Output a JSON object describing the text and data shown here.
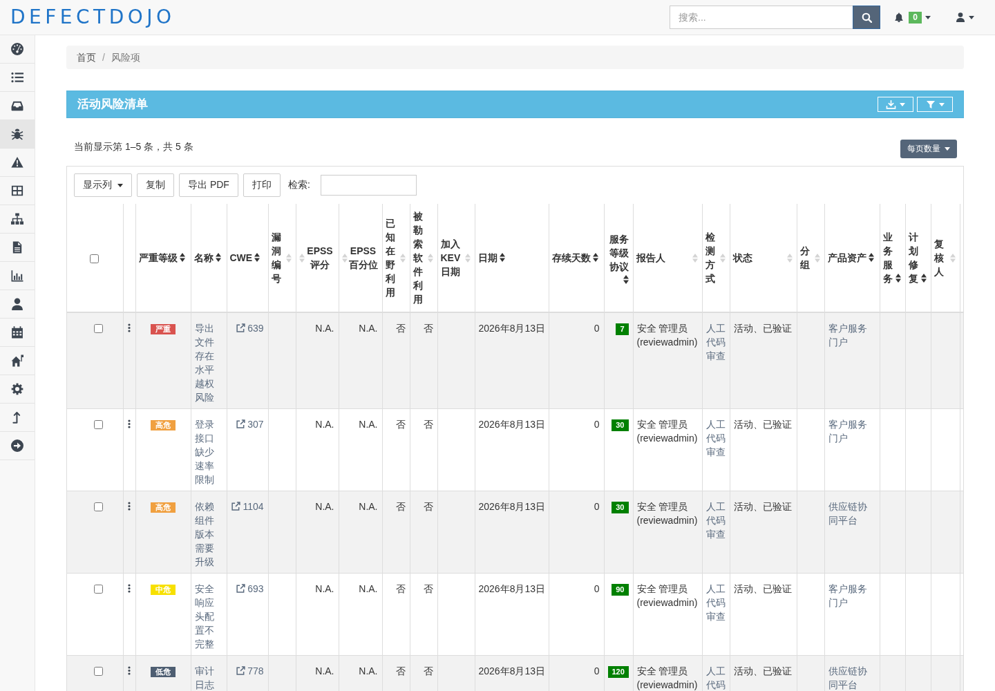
{
  "navbar": {
    "logo": "DEFECTDOJO",
    "search": {
      "placeholder": "搜索..."
    },
    "notifications": {
      "count": "0"
    }
  },
  "sidebar": {
    "items": [
      {
        "kind": "gauge",
        "selected": false
      },
      {
        "kind": "list",
        "selected": false
      },
      {
        "kind": "inbox",
        "selected": false
      },
      {
        "kind": "bug",
        "selected": true
      },
      {
        "kind": "warning",
        "selected": false
      },
      {
        "kind": "grid",
        "selected": false
      },
      {
        "kind": "sitemap",
        "selected": false
      },
      {
        "kind": "document",
        "selected": false
      },
      {
        "kind": "chart",
        "selected": false
      },
      {
        "kind": "user",
        "selected": false
      },
      {
        "kind": "calendar",
        "selected": false
      },
      {
        "kind": "house",
        "selected": false
      },
      {
        "kind": "gear",
        "selected": false
      },
      {
        "kind": "arrow-up",
        "selected": false
      },
      {
        "kind": "arrow-right",
        "selected": false
      }
    ]
  },
  "breadcrumb": {
    "separator": "/",
    "items": [
      {
        "label": "首页",
        "active": false
      },
      {
        "label": "风险项",
        "active": true
      }
    ]
  },
  "panel": {
    "title": "活动风险清单",
    "summary": "当前显示第 1–5 条，共 5 条",
    "page_size_button": "每页数量"
  },
  "toolbar": {
    "buttons": [
      {
        "label": "显示列",
        "dropdown": true
      },
      {
        "label": "复制",
        "dropdown": false
      },
      {
        "label": "导出 PDF",
        "dropdown": false
      },
      {
        "label": "打印",
        "dropdown": false
      }
    ],
    "search_label": "检索:"
  },
  "table": {
    "select_all": {
      "checked": false
    },
    "columns": [
      {
        "label": "严重等级",
        "sortable": true
      },
      {
        "label": "名称",
        "sortable": true
      },
      {
        "label": "CWE",
        "sortable": true
      },
      {
        "label": "漏洞编号",
        "sortable": false
      },
      {
        "label": "EPSS 评分",
        "sortable": false
      },
      {
        "label": "EPSS 百分位",
        "sortable": false
      },
      {
        "label": "已知在野利用",
        "sortable": false
      },
      {
        "label": "被勒索软件利用",
        "sortable": false
      },
      {
        "label": "加入KEV日期",
        "sortable": false
      },
      {
        "label": "日期",
        "sortable": true
      },
      {
        "label": "存续天数",
        "sortable": true
      },
      {
        "label": "服务等级协议",
        "sortable": true
      },
      {
        "label": "报告人",
        "sortable": false
      },
      {
        "label": "检测方式",
        "sortable": false
      },
      {
        "label": "状态",
        "sortable": false
      },
      {
        "label": "分组",
        "sortable": false
      },
      {
        "label": "产品资产",
        "sortable": true
      },
      {
        "label": "业务服务",
        "sortable": true
      },
      {
        "label": "计划修复",
        "sortable": true
      },
      {
        "label": "复核人",
        "sortable": false
      }
    ],
    "rows": [
      {
        "checked": false,
        "severity": {
          "label": "严重",
          "color": "#d9534f"
        },
        "name": "导出文件存在水平越权风险",
        "cwe": "639",
        "epss_score": "N.A.",
        "epss_percentile": "N.A.",
        "known_exploited": "否",
        "ransomware": "否",
        "date": "2026年8月13日",
        "age": "0",
        "sla": "7",
        "reporter": "安全 管理员 (reviewadmin)",
        "detection": "人工代码审查",
        "status": "活动、已验证",
        "product": "客户服务门户"
      },
      {
        "checked": false,
        "severity": {
          "label": "高危",
          "color": "#f0a040"
        },
        "name": "登录接口缺少速率限制",
        "cwe": "307",
        "epss_score": "N.A.",
        "epss_percentile": "N.A.",
        "known_exploited": "否",
        "ransomware": "否",
        "date": "2026年8月13日",
        "age": "0",
        "sla": "30",
        "reporter": "安全 管理员 (reviewadmin)",
        "detection": "人工代码审查",
        "status": "活动、已验证",
        "product": "客户服务门户"
      },
      {
        "checked": false,
        "severity": {
          "label": "高危",
          "color": "#f0a040"
        },
        "name": "依赖组件版本需要升级",
        "cwe": "1104",
        "epss_score": "N.A.",
        "epss_percentile": "N.A.",
        "known_exploited": "否",
        "ransomware": "否",
        "date": "2026年8月13日",
        "age": "0",
        "sla": "30",
        "reporter": "安全 管理员 (reviewadmin)",
        "detection": "人工代码审查",
        "status": "活动、已验证",
        "product": "供应链协同平台"
      },
      {
        "checked": false,
        "severity": {
          "label": "中危",
          "color": "#f7e000"
        },
        "name": "安全响应头配置不完整",
        "cwe": "693",
        "epss_score": "N.A.",
        "epss_percentile": "N.A.",
        "known_exploited": "否",
        "ransomware": "否",
        "date": "2026年8月13日",
        "age": "0",
        "sla": "90",
        "reporter": "安全 管理员 (reviewadmin)",
        "detection": "人工代码审查",
        "status": "活动、已验证",
        "product": "客户服务门户"
      },
      {
        "checked": false,
        "severity": {
          "label": "低危",
          "color": "#4e5e72"
        },
        "name": "审计日志",
        "cwe": "778",
        "epss_score": "N.A.",
        "epss_percentile": "N.A.",
        "known_exploited": "否",
        "ransomware": "否",
        "date": "2026年8月13日",
        "age": "0",
        "sla": "120",
        "reporter": "安全 管理员 (reviewadmin)",
        "detection": "人工代码",
        "status": "活动、已验证",
        "product": "供应链协同平台"
      }
    ]
  }
}
